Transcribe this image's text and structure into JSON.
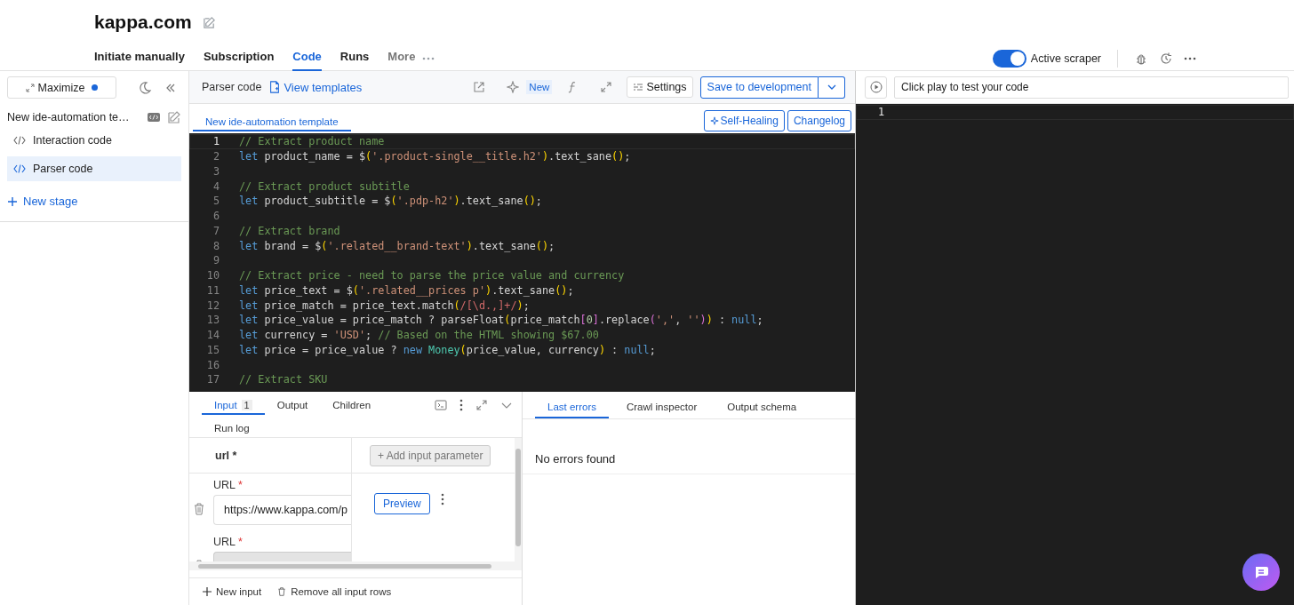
{
  "page_title": "kappa.com",
  "nav_tabs": [
    {
      "label": "Initiate manually",
      "selected": false
    },
    {
      "label": "Subscription",
      "selected": false
    },
    {
      "label": "Code",
      "selected": true
    },
    {
      "label": "Runs",
      "selected": false
    },
    {
      "label": "More",
      "selected": false
    }
  ],
  "scraper_toggle": {
    "label": "Active scraper",
    "on": true
  },
  "sidebar": {
    "maximize": "Maximize",
    "template_name": "New ide-automation te…",
    "items": [
      {
        "label": "Interaction code",
        "selected": false
      },
      {
        "label": "Parser code",
        "selected": true
      }
    ],
    "new_stage": "New stage"
  },
  "editor": {
    "title": "Parser code",
    "view_templates": "View templates",
    "new_badge": "New",
    "settings": "Settings",
    "save": "Save to development",
    "file_tab": {
      "label": "New ide-automation template",
      "selected": true
    },
    "self_healing": "Self-Healing",
    "changelog": "Changelog",
    "lines": [
      {
        "number": "1",
        "tokens": [
          {
            "kind": "comment",
            "text": "// Extract product name"
          }
        ]
      },
      {
        "number": "2",
        "tokens": [
          {
            "kind": "keyword",
            "text": "let"
          },
          {
            "kind": "plain",
            "text": " product_name = $"
          },
          {
            "kind": "paren",
            "text": "("
          },
          {
            "kind": "string",
            "text": "'.product-single__title.h2'"
          },
          {
            "kind": "paren",
            "text": ")"
          },
          {
            "kind": "plain",
            "text": ".text_sane"
          },
          {
            "kind": "paren",
            "text": "()"
          },
          {
            "kind": "plain",
            "text": ";"
          }
        ]
      },
      {
        "number": "3"
      },
      {
        "number": "4",
        "tokens": [
          {
            "kind": "comment",
            "text": "// Extract product subtitle"
          }
        ]
      },
      {
        "number": "5",
        "tokens": [
          {
            "kind": "keyword",
            "text": "let"
          },
          {
            "kind": "plain",
            "text": " product_subtitle = $"
          },
          {
            "kind": "paren",
            "text": "("
          },
          {
            "kind": "string",
            "text": "'.pdp-h2'"
          },
          {
            "kind": "paren",
            "text": ")"
          },
          {
            "kind": "plain",
            "text": ".text_sane"
          },
          {
            "kind": "paren",
            "text": "()"
          },
          {
            "kind": "plain",
            "text": ";"
          }
        ]
      },
      {
        "number": "6"
      },
      {
        "number": "7",
        "tokens": [
          {
            "kind": "comment",
            "text": "// Extract brand"
          }
        ]
      },
      {
        "number": "8",
        "tokens": [
          {
            "kind": "keyword",
            "text": "let"
          },
          {
            "kind": "plain",
            "text": " brand = $"
          },
          {
            "kind": "paren",
            "text": "("
          },
          {
            "kind": "string",
            "text": "'.related__brand-text'"
          },
          {
            "kind": "paren",
            "text": ")"
          },
          {
            "kind": "plain",
            "text": ".text_sane"
          },
          {
            "kind": "paren",
            "text": "()"
          },
          {
            "kind": "plain",
            "text": ";"
          }
        ]
      },
      {
        "number": "9"
      },
      {
        "number": "10",
        "tokens": [
          {
            "kind": "comment",
            "text": "// Extract price - need to parse the price value and currency"
          }
        ]
      },
      {
        "number": "11",
        "tokens": [
          {
            "kind": "keyword",
            "text": "let"
          },
          {
            "kind": "plain",
            "text": " price_text = $"
          },
          {
            "kind": "paren",
            "text": "("
          },
          {
            "kind": "string",
            "text": "'.related__prices p'"
          },
          {
            "kind": "paren",
            "text": ")"
          },
          {
            "kind": "plain",
            "text": ".text_sane"
          },
          {
            "kind": "paren",
            "text": "()"
          },
          {
            "kind": "plain",
            "text": ";"
          }
        ]
      },
      {
        "number": "12",
        "tokens": [
          {
            "kind": "keyword",
            "text": "let"
          },
          {
            "kind": "plain",
            "text": " price_match = price_text.match"
          },
          {
            "kind": "paren",
            "text": "("
          },
          {
            "kind": "regex",
            "text": "/[\\d.,]+/"
          },
          {
            "kind": "paren",
            "text": ")"
          },
          {
            "kind": "plain",
            "text": ";"
          }
        ]
      },
      {
        "number": "13",
        "tokens": [
          {
            "kind": "keyword",
            "text": "let"
          },
          {
            "kind": "plain",
            "text": " price_value = price_match ? parseFloat"
          },
          {
            "kind": "paren",
            "text": "("
          },
          {
            "kind": "plain",
            "text": "price_match"
          },
          {
            "kind": "paren2",
            "text": "["
          },
          {
            "kind": "number",
            "text": "0"
          },
          {
            "kind": "paren2",
            "text": "]"
          },
          {
            "kind": "plain",
            "text": ".replace"
          },
          {
            "kind": "paren2",
            "text": "("
          },
          {
            "kind": "string",
            "text": "','"
          },
          {
            "kind": "plain",
            "text": ", "
          },
          {
            "kind": "string",
            "text": "''"
          },
          {
            "kind": "paren2",
            "text": ")"
          },
          {
            "kind": "paren",
            "text": ")"
          },
          {
            "kind": "plain",
            "text": " : "
          },
          {
            "kind": "keyword",
            "text": "null"
          },
          {
            "kind": "plain",
            "text": ";"
          }
        ]
      },
      {
        "number": "14",
        "tokens": [
          {
            "kind": "keyword",
            "text": "let"
          },
          {
            "kind": "plain",
            "text": " currency = "
          },
          {
            "kind": "string",
            "text": "'USD'"
          },
          {
            "kind": "plain",
            "text": "; "
          },
          {
            "kind": "comment",
            "text": "// Based on the HTML showing $67.00"
          }
        ]
      },
      {
        "number": "15",
        "tokens": [
          {
            "kind": "keyword",
            "text": "let"
          },
          {
            "kind": "plain",
            "text": " price = price_value ? "
          },
          {
            "kind": "keyword",
            "text": "new"
          },
          {
            "kind": "class",
            "text": " Money"
          },
          {
            "kind": "paren",
            "text": "("
          },
          {
            "kind": "plain",
            "text": "price_value, currency"
          },
          {
            "kind": "paren",
            "text": ")"
          },
          {
            "kind": "plain",
            "text": " : "
          },
          {
            "kind": "keyword",
            "text": "null"
          },
          {
            "kind": "plain",
            "text": ";"
          }
        ]
      },
      {
        "number": "16"
      },
      {
        "number": "17",
        "tokens": [
          {
            "kind": "comment",
            "text": "// Extract SKU"
          }
        ]
      }
    ]
  },
  "input_panel": {
    "tabs": [
      {
        "label": "Input",
        "count": "1",
        "selected": true
      },
      {
        "label": "Output",
        "selected": false
      },
      {
        "label": "Children",
        "selected": false
      },
      {
        "label": "Run log",
        "selected": false
      }
    ],
    "column_header": "url *",
    "add_parameter": {
      "label": "+ Add input parameter",
      "disabled": true
    },
    "rows": [
      {
        "label": "URL",
        "required": "*",
        "value": "https://www.kappa.com/p",
        "disabled": false,
        "preview": "Preview"
      },
      {
        "label": "URL",
        "required": "*",
        "disabled": true
      }
    ],
    "new_input": "New input",
    "remove_all": "Remove all input rows"
  },
  "errors_panel": {
    "tabs": [
      {
        "label": "Last errors",
        "selected": true
      },
      {
        "label": "Crawl inspector",
        "selected": false
      },
      {
        "label": "Output schema",
        "selected": false
      }
    ],
    "message": "No errors found"
  },
  "test_panel": {
    "placeholder": "Click play to test your code",
    "line_numbers": [
      "1"
    ]
  }
}
